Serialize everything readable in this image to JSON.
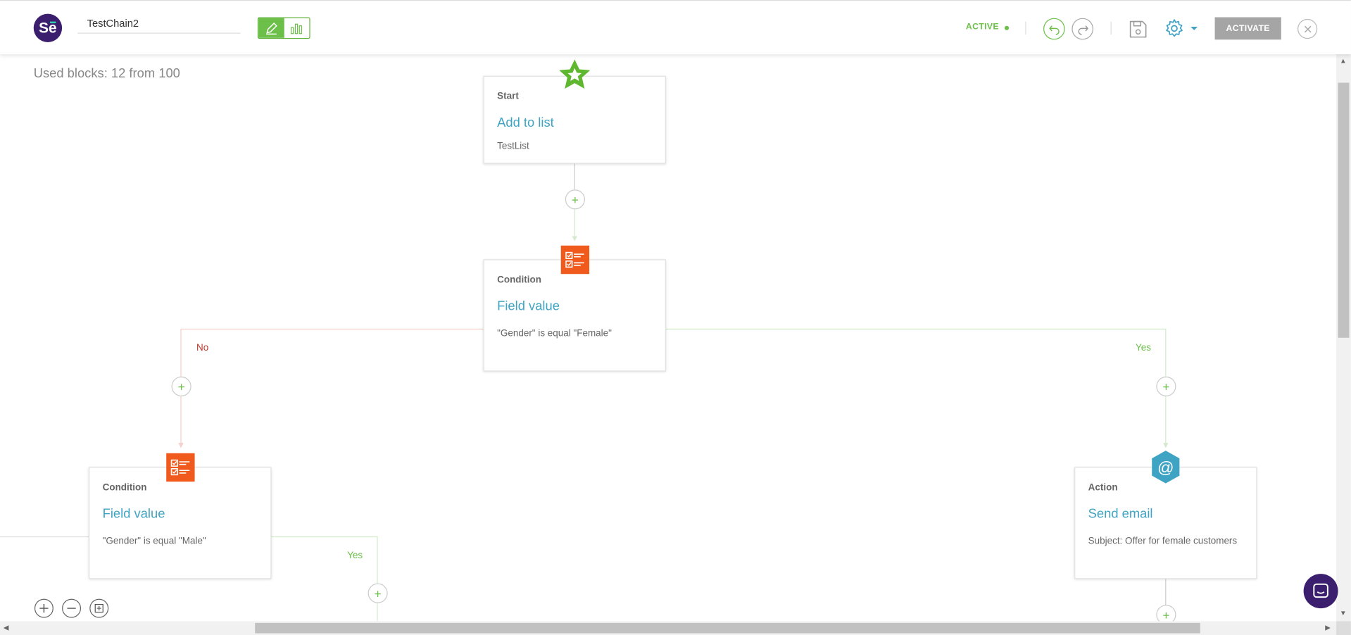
{
  "header": {
    "logo_text": "Se",
    "chain_name": "TestChain2",
    "status": "ACTIVE",
    "activate_label": "ACTIVATE"
  },
  "canvas": {
    "used_blocks": "Used blocks: 12 from 100",
    "blocks": [
      {
        "kind": "Start",
        "title": "Add to list",
        "desc": "TestList"
      },
      {
        "kind": "Condition",
        "title": "Field value",
        "desc": "\"Gender\" is equal \"Female\""
      },
      {
        "kind": "Condition",
        "title": "Field value",
        "desc": "\"Gender\" is equal \"Male\""
      },
      {
        "kind": "Action",
        "title": "Send email",
        "desc": "Subject: Offer for female customers"
      }
    ],
    "branch_labels": {
      "no": "No",
      "yes": "Yes"
    },
    "plus_symbol": "+"
  },
  "colors": {
    "accent_green": "#6cc04a",
    "title_blue": "#3fa3c3",
    "condition_orange": "#f15a1d",
    "action_teal": "#3fa3c3",
    "no_red": "#c0392b",
    "brand_purple": "#3b1f6e"
  },
  "icons": {
    "logo": "sendpulse-logo",
    "edit": "pencil-icon",
    "stats": "bar-chart-icon",
    "undo": "undo-icon",
    "redo": "redo-icon",
    "save": "floppy-disk-icon",
    "settings": "gear-icon",
    "close": "close-icon",
    "start": "star-icon",
    "condition": "checklist-icon",
    "action": "at-sign-icon",
    "zoom_in": "zoom-in-icon",
    "zoom_out": "zoom-out-icon",
    "fit": "fit-to-screen-icon",
    "chat": "chat-icon"
  }
}
